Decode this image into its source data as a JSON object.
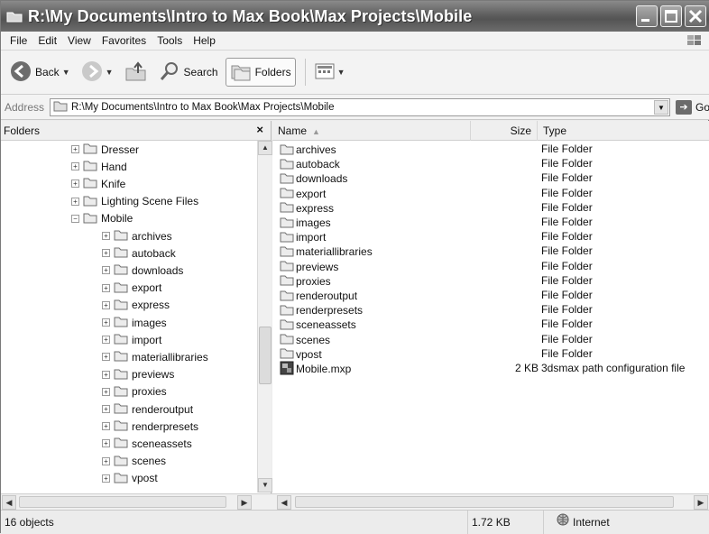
{
  "window": {
    "title": "R:\\My Documents\\Intro to Max Book\\Max Projects\\Mobile"
  },
  "menu": [
    "File",
    "Edit",
    "View",
    "Favorites",
    "Tools",
    "Help"
  ],
  "toolbar": {
    "back_label": "Back",
    "search_label": "Search",
    "folders_label": "Folders"
  },
  "address": {
    "label": "Address",
    "value": "R:\\My Documents\\Intro to Max Book\\Max Projects\\Mobile",
    "go_label": "Go"
  },
  "folders_pane": {
    "title": "Folders",
    "close_glyph": "×",
    "tree": [
      {
        "label": "Dresser",
        "level": 0,
        "expander": "+"
      },
      {
        "label": "Hand",
        "level": 0,
        "expander": "+"
      },
      {
        "label": "Knife",
        "level": 0,
        "expander": "+"
      },
      {
        "label": "Lighting Scene Files",
        "level": 0,
        "expander": "+"
      },
      {
        "label": "Mobile",
        "level": 0,
        "expander": "−"
      },
      {
        "label": "archives",
        "level": 1,
        "expander": "+"
      },
      {
        "label": "autoback",
        "level": 1,
        "expander": "+"
      },
      {
        "label": "downloads",
        "level": 1,
        "expander": "+"
      },
      {
        "label": "export",
        "level": 1,
        "expander": "+"
      },
      {
        "label": "express",
        "level": 1,
        "expander": "+"
      },
      {
        "label": "images",
        "level": 1,
        "expander": "+"
      },
      {
        "label": "import",
        "level": 1,
        "expander": "+"
      },
      {
        "label": "materiallibraries",
        "level": 1,
        "expander": "+"
      },
      {
        "label": "previews",
        "level": 1,
        "expander": "+"
      },
      {
        "label": "proxies",
        "level": 1,
        "expander": "+"
      },
      {
        "label": "renderoutput",
        "level": 1,
        "expander": "+"
      },
      {
        "label": "renderpresets",
        "level": 1,
        "expander": "+"
      },
      {
        "label": "sceneassets",
        "level": 1,
        "expander": "+"
      },
      {
        "label": "scenes",
        "level": 1,
        "expander": "+"
      },
      {
        "label": "vpost",
        "level": 1,
        "expander": "+"
      }
    ]
  },
  "file_list": {
    "columns": {
      "name": "Name",
      "size": "Size",
      "type": "Type"
    },
    "rows": [
      {
        "name": "archives",
        "size": "",
        "type": "File Folder",
        "icon": "folder-icon"
      },
      {
        "name": "autoback",
        "size": "",
        "type": "File Folder",
        "icon": "folder-icon"
      },
      {
        "name": "downloads",
        "size": "",
        "type": "File Folder",
        "icon": "folder-icon"
      },
      {
        "name": "export",
        "size": "",
        "type": "File Folder",
        "icon": "folder-icon"
      },
      {
        "name": "express",
        "size": "",
        "type": "File Folder",
        "icon": "folder-icon"
      },
      {
        "name": "images",
        "size": "",
        "type": "File Folder",
        "icon": "folder-icon"
      },
      {
        "name": "import",
        "size": "",
        "type": "File Folder",
        "icon": "folder-icon"
      },
      {
        "name": "materiallibraries",
        "size": "",
        "type": "File Folder",
        "icon": "folder-icon"
      },
      {
        "name": "previews",
        "size": "",
        "type": "File Folder",
        "icon": "folder-icon"
      },
      {
        "name": "proxies",
        "size": "",
        "type": "File Folder",
        "icon": "folder-icon"
      },
      {
        "name": "renderoutput",
        "size": "",
        "type": "File Folder",
        "icon": "folder-icon"
      },
      {
        "name": "renderpresets",
        "size": "",
        "type": "File Folder",
        "icon": "folder-icon"
      },
      {
        "name": "sceneassets",
        "size": "",
        "type": "File Folder",
        "icon": "folder-icon"
      },
      {
        "name": "scenes",
        "size": "",
        "type": "File Folder",
        "icon": "folder-icon"
      },
      {
        "name": "vpost",
        "size": "",
        "type": "File Folder",
        "icon": "folder-icon"
      },
      {
        "name": "Mobile.mxp",
        "size": "2 KB",
        "type": "3dsmax path configuration file",
        "icon": "mxp-file-icon"
      }
    ]
  },
  "status": {
    "objects": "16 objects",
    "size": "1.72 KB",
    "zone": "Internet"
  }
}
